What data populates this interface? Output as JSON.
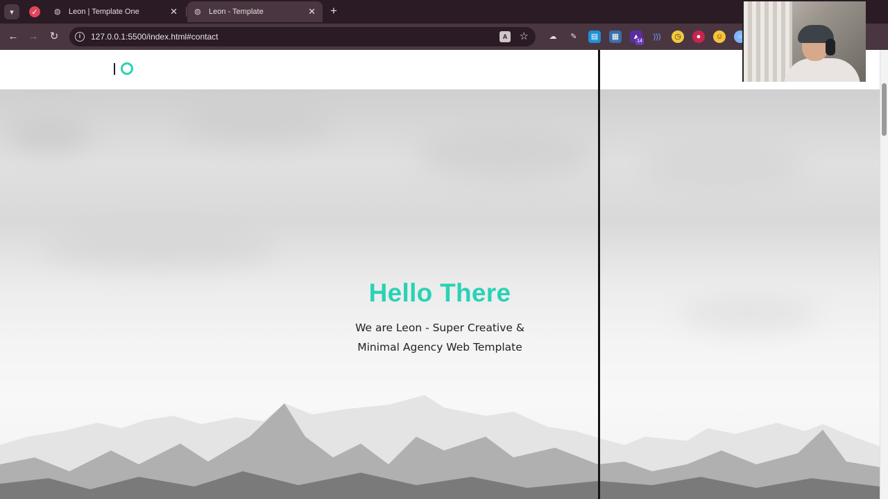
{
  "browser": {
    "tabs": [
      {
        "title": "Leon | Template One",
        "active": false
      },
      {
        "title": "Leon - Template",
        "active": true
      }
    ],
    "url": "127.0.0.1:5500/index.html#contact",
    "extension_badge": "14"
  },
  "site": {
    "hero": {
      "title": "Hello There",
      "subtitle_line1": "We are Leon - Super Creative &",
      "subtitle_line2": "Minimal Agency Web Template"
    }
  },
  "colors": {
    "accent": "#2ad2b5",
    "chrome_dark": "#2a1b24",
    "chrome_mid": "#4a3640"
  }
}
